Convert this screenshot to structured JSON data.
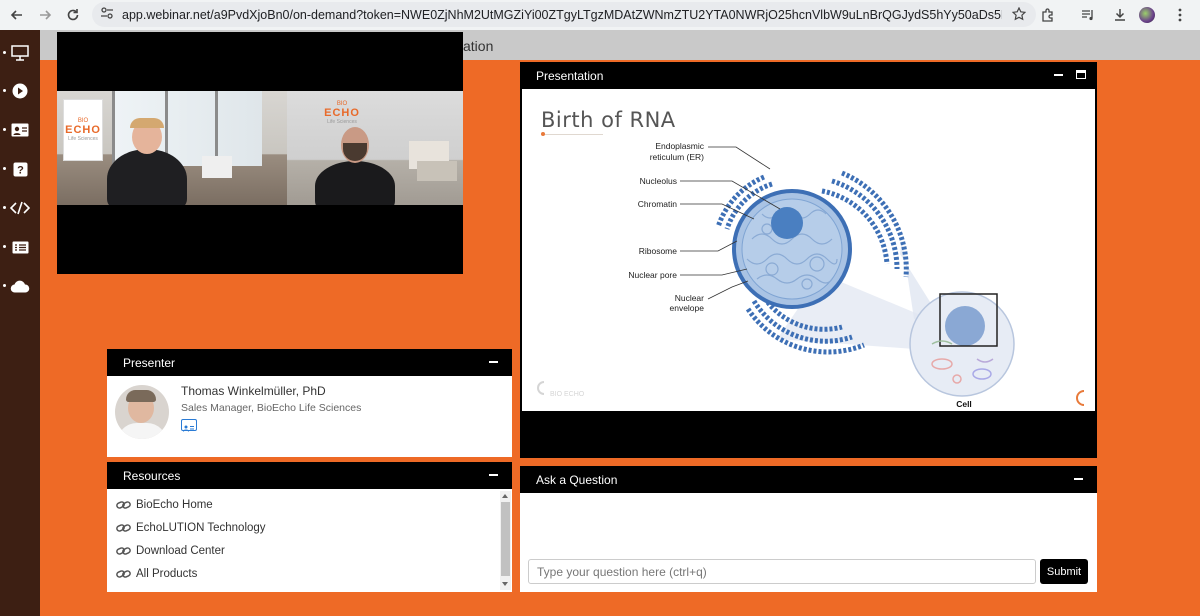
{
  "browser": {
    "url": "app.webinar.net/a9PvdXjoBn0/on-demand?token=NWE0ZjNhM2UtMGZiYi00ZTgyLTgzMDAtZWNmZTU2YTA0NWRjO25hcnVlbW9uLnBrQGJydS5hYy50aDs5NmQxZDk2NTZkNWE2N..."
  },
  "page": {
    "band_title_fragment": "ation"
  },
  "sidebar": {
    "icons": [
      "presentation-icon",
      "play-icon",
      "contact-card-icon",
      "question-icon",
      "code-icon",
      "list-icon",
      "cloud-icon"
    ]
  },
  "presentation": {
    "title": "Presentation",
    "slide": {
      "title": "Birth of RNA",
      "labels": {
        "er": "Endoplasmic",
        "er2": "reticulum (ER)",
        "nucleolus": "Nucleolus",
        "chromatin": "Chromatin",
        "ribosome": "Ribosome",
        "pore": "Nuclear pore",
        "envelope": "Nuclear",
        "envelope2": "envelope",
        "cell": "Cell"
      },
      "logo_text": "BIO ECHO"
    }
  },
  "presenter": {
    "title": "Presenter",
    "name": "Thomas Winkelmüller, PhD",
    "role": "Sales Manager, BioEcho Life Sciences"
  },
  "resources": {
    "title": "Resources",
    "items": [
      "BioEcho Home",
      "EchoLUTION Technology",
      "Download Center",
      "All Products"
    ]
  },
  "question": {
    "title": "Ask a Question",
    "placeholder": "Type your question here (ctrl+q)",
    "submit_label": "Submit"
  },
  "video": {
    "logo_left": "ECHO",
    "logo_left_sub": "Life Sciences",
    "logo_right": "ECHO",
    "logo_right_sub": "Life Sciences",
    "logo_top": "BIO"
  },
  "colors": {
    "accent": "#ee6a26",
    "sidebar": "#3d1f13",
    "diagram_blue": "#4a7fc1"
  }
}
